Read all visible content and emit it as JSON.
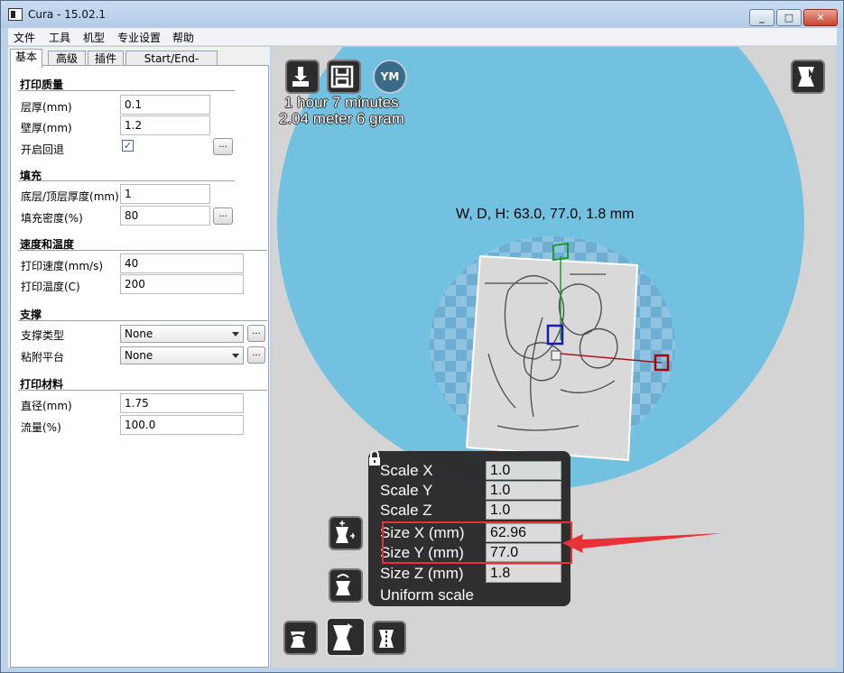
{
  "window": {
    "title": "Cura - 15.02.1"
  },
  "menu": [
    "文件",
    "工具",
    "机型",
    "专业设置",
    "帮助"
  ],
  "tabs": [
    "基本",
    "高级",
    "插件",
    "Start/End-GCode"
  ],
  "sections": {
    "quality": {
      "title": "打印质量",
      "layer_height_label": "层厚(mm)",
      "layer_height": "0.1",
      "shell_label": "壁厚(mm)",
      "shell": "1.2",
      "retraction_label": "开启回退",
      "retraction_checked": "✓"
    },
    "fill": {
      "title": "填充",
      "bottom_top_label": "底层/顶层厚度(mm)",
      "bottom_top": "1",
      "density_label": "填充密度(%)",
      "density": "80"
    },
    "speed": {
      "title": "速度和温度",
      "print_speed_label": "打印速度(mm/s)",
      "print_speed": "40",
      "temperature_label": "打印温度(C)",
      "temperature": "200"
    },
    "support": {
      "title": "支撑",
      "support_type_label": "支撑类型",
      "support_type": "None",
      "adhesion_label": "粘附平台",
      "adhesion": "None"
    },
    "filament": {
      "title": "打印材料",
      "diameter_label": "直径(mm)",
      "diameter": "1.75",
      "flow_label": "流量(%)",
      "flow": "100.0"
    }
  },
  "dots_label": "...",
  "viewport": {
    "print_time": "1 hour 7 minutes",
    "print_material": "2.04 meter 6 gram",
    "ym_label": "YM",
    "dimensions": "W, D, H: 63.0, 77.0, 1.8 mm"
  },
  "scale_panel": {
    "rows": [
      {
        "label": "Scale X",
        "value": "1.0"
      },
      {
        "label": "Scale Y",
        "value": "1.0"
      },
      {
        "label": "Scale Z",
        "value": "1.0"
      },
      {
        "label": "Size X (mm)",
        "value": "62.96"
      },
      {
        "label": "Size Y (mm)",
        "value": "77.0"
      },
      {
        "label": "Size Z (mm)",
        "value": "1.8"
      }
    ],
    "uniform_label": "Uniform scale"
  },
  "colors": {
    "platform": "#73c1e0",
    "background": "#d4d4d4",
    "highlight": "#e8323a"
  }
}
